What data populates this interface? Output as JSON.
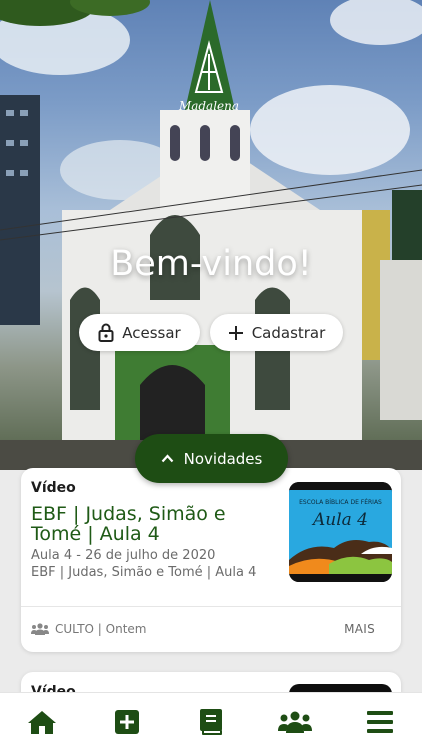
{
  "hero": {
    "logo_text": "Madalena",
    "welcome": "Bem-vindo!",
    "login_label": "Acessar",
    "signup_label": "Cadastrar"
  },
  "novidades_label": "Novidades",
  "feed": [
    {
      "type": "Vídeo",
      "title": "EBF | Judas, Simão e Tomé | Aula 4",
      "subtitle_line1": "Aula 4 - 26 de julho de 2020",
      "subtitle_line2": "EBF | Judas, Simão e Tomé | Aula 4",
      "meta": "CULTO | Ontem",
      "more_label": "MAIS",
      "thumbnail": {
        "header": "ESCOLA BÍBLICA DE FÉRIAS",
        "title": "Aula 4"
      }
    },
    {
      "type": "Vídeo"
    }
  ],
  "tabbar": {
    "items": [
      "home-icon",
      "add-icon",
      "bible-icon",
      "community-icon",
      "menu-icon"
    ]
  },
  "colors": {
    "primary_green": "#1e4d14",
    "title_green": "#1f5a16",
    "thumbnail_blue": "#29a8e0"
  }
}
